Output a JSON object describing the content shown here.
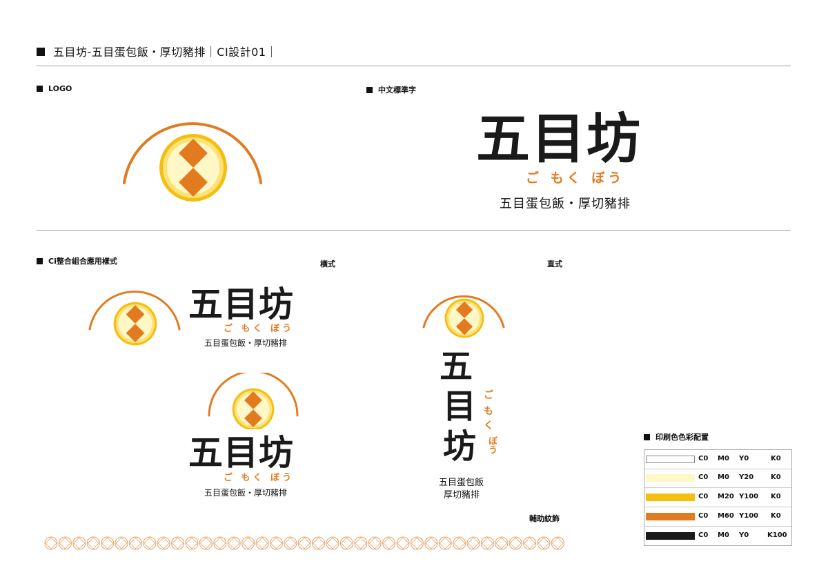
{
  "page": {
    "title": "五目坊-五目蛋包飯・厚切豬排｜CI設計01｜"
  },
  "sections": {
    "logo": "LOGO",
    "chinese_type": "中文標準字",
    "ci_combo": "Ci整合組合應用樣式",
    "horizontal": "橫式",
    "vertical": "直式",
    "pattern": "輔助紋飾",
    "print_colors": "印刷色色彩配置"
  },
  "brand": {
    "name": "五目坊",
    "name_chars": [
      "五",
      "目",
      "坊"
    ],
    "kana": "ご もく ぼう",
    "kana_v1": "ご",
    "kana_v2": "も",
    "kana_v3": "く",
    "kana_v4": "ぼう",
    "subtitle": "五目蛋包飯・厚切豬排",
    "subtitle_line1": "五目蛋包飯",
    "subtitle_line2": "厚切豬排"
  },
  "colors": {
    "white": "#ffffff",
    "cream": "#fff7c6",
    "yellow": "#f5bf10",
    "orange": "#e27b1f",
    "black": "#1a1a1a"
  },
  "palette": [
    {
      "c": "C0",
      "m": "M0",
      "y": "Y0",
      "k": "K0",
      "hex": "#ffffff"
    },
    {
      "c": "C0",
      "m": "M0",
      "y": "Y20",
      "k": "K0",
      "hex": "#fff7c6"
    },
    {
      "c": "C0",
      "m": "M20",
      "y": "Y100",
      "k": "K0",
      "hex": "#f5bf10"
    },
    {
      "c": "C0",
      "m": "M60",
      "y": "Y100",
      "k": "K0",
      "hex": "#e27b1f"
    },
    {
      "c": "C0",
      "m": "M0",
      "y": "Y0",
      "k": "K100",
      "hex": "#1a1a1a"
    }
  ]
}
